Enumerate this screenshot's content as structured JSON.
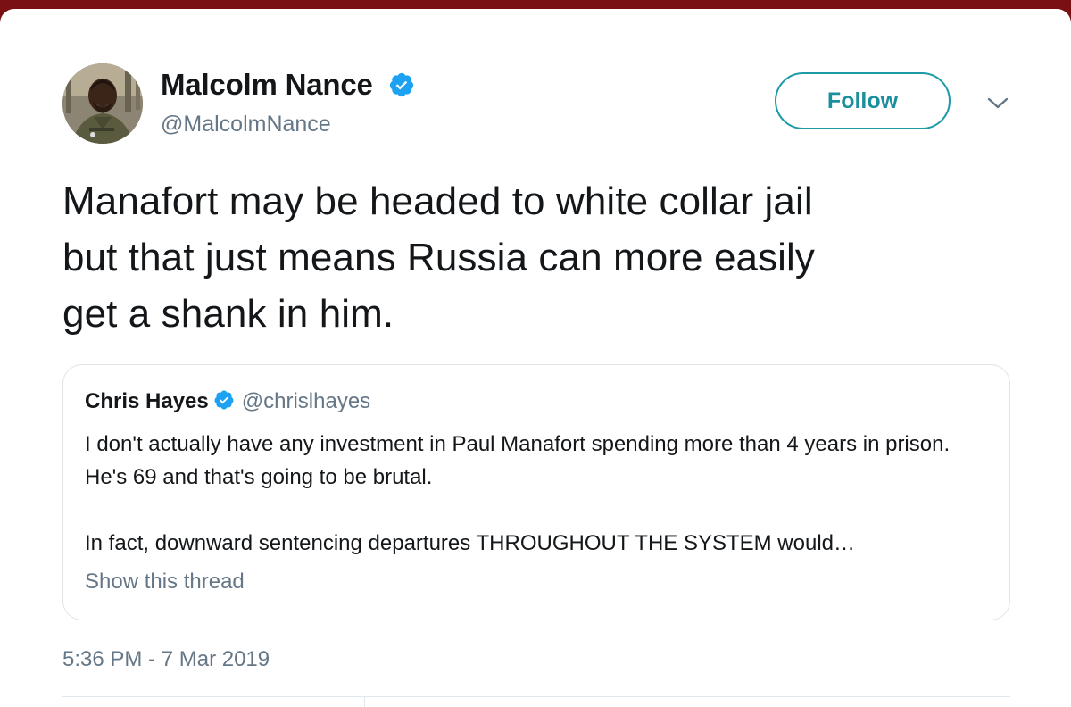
{
  "tweet": {
    "author": {
      "name": "Malcolm Nance",
      "handle": "@MalcolmNance",
      "verified": true
    },
    "follow_label": "Follow",
    "text": "Manafort may be headed to white collar jail\nbut that just means Russia can more easily\nget a shank in him.",
    "timestamp": "5:36 PM - 7 Mar 2019"
  },
  "quoted": {
    "name": "Chris Hayes",
    "handle": "@chrislhayes",
    "verified": true,
    "para1": "I don't actually have any investment in Paul Manafort spending more than 4 years in prison. He's 69 and that's going to be brutal.",
    "para2": "In fact, downward sentencing departures THROUGHOUT THE SYSTEM would…",
    "show_thread": "Show this thread"
  },
  "colors": {
    "verified": "#1da1f2",
    "follow_accent": "#1b9aa8",
    "secondary_text": "#657786",
    "top_bar": "#7a0f14"
  },
  "icons": {
    "verified": "verified-badge-icon",
    "more": "chevron-down-icon"
  }
}
